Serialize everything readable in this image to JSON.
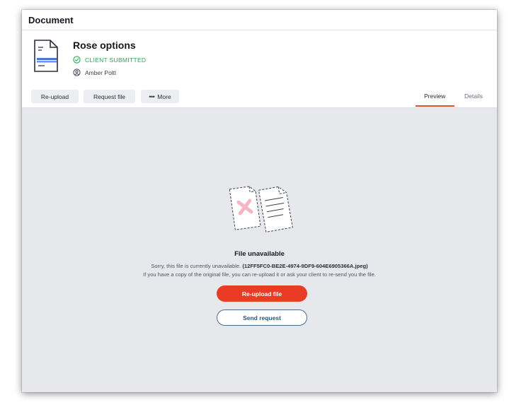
{
  "window": {
    "title": "Document"
  },
  "document": {
    "name": "Rose options",
    "status": "CLIENT SUBMITTED",
    "client": "Amber Poltl"
  },
  "toolbar": {
    "reupload_label": "Re-upload",
    "request_label": "Request file",
    "more_label": "More"
  },
  "tabs": [
    {
      "label": "Preview",
      "active": true
    },
    {
      "label": "Details",
      "active": false
    }
  ],
  "empty_state": {
    "title": "File unavailable",
    "line1_prefix": "Sorry, this file is currently unavailable.",
    "file_ref": "(12FF5FC0-BE2E-4974-9DF9-604E6905366A.jpeg)",
    "line2": "If you have a copy of the original file, you can re-upload it or ask your client to re-send you the file.",
    "primary_button": "Re-upload file",
    "secondary_button": "Send request"
  },
  "colors": {
    "accent": "#ea3b25",
    "status_green": "#2fa558",
    "secondary_blue": "#2d5478",
    "canvas": "#e6e8ec"
  },
  "icons": {
    "document": "document-icon",
    "status": "check-circle-icon",
    "client": "user-circle-icon",
    "more": "ellipsis-icon",
    "empty": "broken-files-icon"
  }
}
